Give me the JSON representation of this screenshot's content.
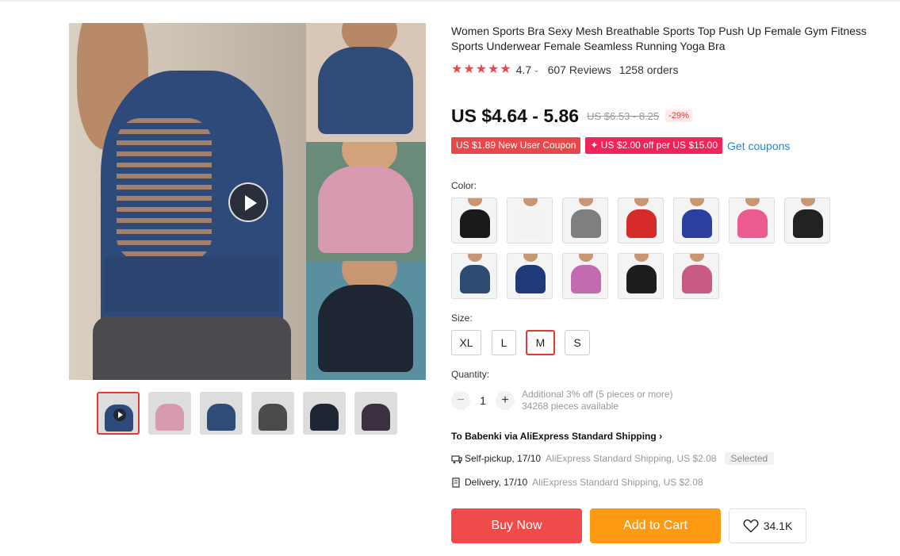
{
  "product": {
    "title": "Women Sports Bra Sexy Mesh Breathable Sports Top Push Up Female Gym Fitness Sports Underwear Female Seamless Running Yoga Bra",
    "rating": "4.7",
    "reviews": "607 Reviews",
    "orders": "1258 orders",
    "price": "US $4.64 - 5.86",
    "old_price": "US $6.53 - 8.25",
    "discount": "-29%"
  },
  "coupons": {
    "new_user": "US $1.89 New User Coupon",
    "store": "✦ US $2.00 off per US $15.00",
    "get_label": "Get coupons"
  },
  "color": {
    "label": "Color:",
    "swatches": [
      {
        "name": "black",
        "color": "#1a1a1a"
      },
      {
        "name": "white",
        "color": "#f2f2f2"
      },
      {
        "name": "gray",
        "color": "#7d7f80"
      },
      {
        "name": "red",
        "color": "#d62b2b"
      },
      {
        "name": "blue",
        "color": "#2c3fa0"
      },
      {
        "name": "pink",
        "color": "#ec5b8f"
      },
      {
        "name": "black-mesh",
        "color": "#222222"
      },
      {
        "name": "navy",
        "color": "#2e4a72"
      },
      {
        "name": "royal-blue",
        "color": "#1f3a7a"
      },
      {
        "name": "orchid",
        "color": "#c46ab0"
      },
      {
        "name": "black-2",
        "color": "#1d1d1d"
      },
      {
        "name": "rose",
        "color": "#c85b86"
      }
    ]
  },
  "size": {
    "label": "Size:",
    "options": [
      "XL",
      "L",
      "M",
      "S"
    ],
    "selected": "M"
  },
  "quantity": {
    "label": "Quantity:",
    "minus": "−",
    "value": "1",
    "plus": "+",
    "discount_note": "Additional 3% off (5 pieces or more)",
    "available": "34268 pieces available"
  },
  "shipping": {
    "title": "To Babenki via AliExpress Standard Shipping",
    "chevron": "›",
    "pickup_main": "Self-pickup, 17/10",
    "pickup_sub": "AliExpress Standard Shipping, US $2.08",
    "selected_tag": "Selected",
    "delivery_main": "Delivery, 17/10",
    "delivery_sub": "AliExpress Standard Shipping, US $2.08"
  },
  "actions": {
    "buy_now": "Buy Now",
    "add_to_cart": "Add to Cart",
    "wishlist_count": "34.1K"
  },
  "colors": {
    "star": "#e8484a",
    "buy_now": "#f14a4a",
    "add_to_cart": "#fd9a12",
    "accent_red": "#e53935",
    "link": "#2a86c9"
  }
}
